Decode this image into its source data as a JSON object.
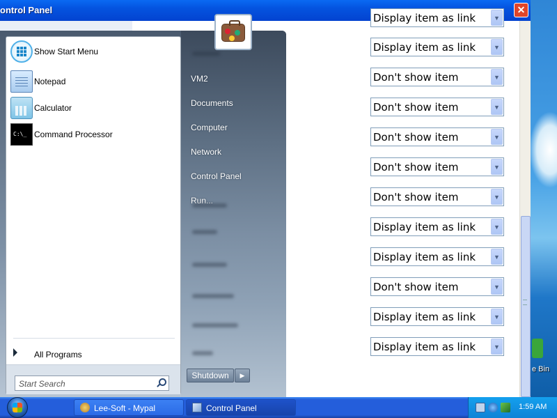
{
  "window": {
    "title": "ontrol Panel",
    "close_label": "✕"
  },
  "settings_dropdowns": [
    "Display item as link",
    "Display item as link",
    "Don't show item",
    "Don't show item",
    "Don't show item",
    "Don't show item",
    "Don't show item",
    "Display item as link",
    "Display item as link",
    "Don't show item",
    "Display item as link",
    "Display item as link"
  ],
  "start_menu": {
    "pinned": [
      {
        "label": "Show Start Menu",
        "icon": "start-menu-icon"
      },
      {
        "label": "Notepad",
        "icon": "notepad-icon"
      },
      {
        "label": "Calculator",
        "icon": "calculator-icon"
      },
      {
        "label": "Command Processor",
        "icon": "command-prompt-icon",
        "glyph": "C:\\_"
      }
    ],
    "all_programs": "All Programs",
    "search_placeholder": "Start Search",
    "right_items": [
      "VM2",
      "Documents",
      "Computer",
      "Network",
      "Control Panel",
      "Run..."
    ],
    "shutdown_label": "Shutdown",
    "shutdown_arrow": "▶"
  },
  "taskbar": {
    "buttons": [
      {
        "label": "Lee-Soft - Mypal",
        "icon": "lee-soft-icon",
        "active": false
      },
      {
        "label": "Control Panel",
        "icon": "control-panel-icon",
        "active": true
      }
    ],
    "clock": "1:59 AM"
  },
  "desktop": {
    "recycle_bin_label": "e Bin"
  },
  "colors": {
    "title_bar": "#0453df",
    "taskbar": "#245edb",
    "tray": "#0f83d6",
    "start_menu_right": "#5d6f83"
  }
}
